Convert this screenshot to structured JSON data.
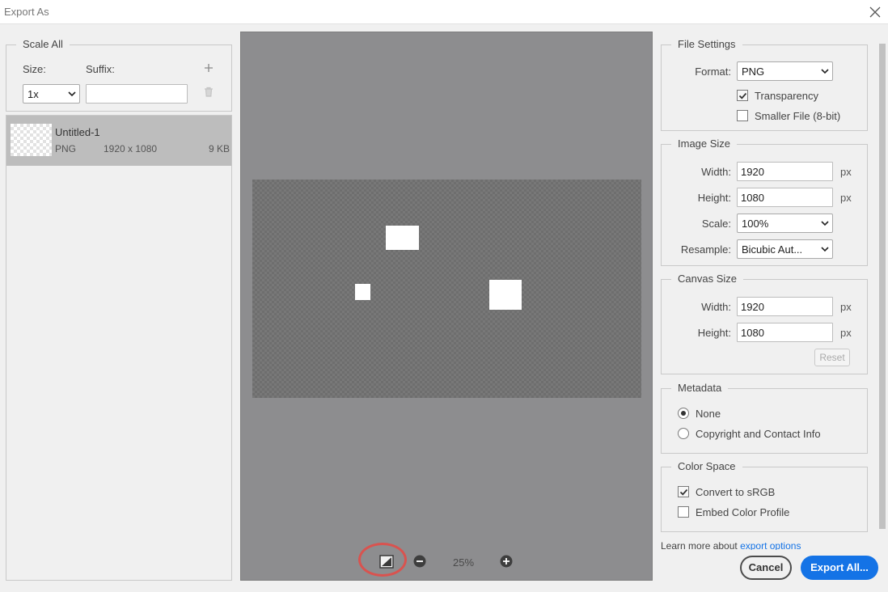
{
  "window": {
    "title": "Export As",
    "close_icon": "close-icon"
  },
  "left": {
    "scale_all_legend": "Scale All",
    "size_label": "Size:",
    "suffix_label": "Suffix:",
    "size_value": "1x",
    "suffix_value": "",
    "add_icon": "plus-icon",
    "delete_icon": "trash-icon",
    "asset": {
      "name": "Untitled-1",
      "format": "PNG",
      "dimensions": "1920 x 1080",
      "filesize": "9 KB"
    }
  },
  "preview": {
    "zoom_level": "25%",
    "toggle_icon": "toggle-background-icon",
    "zoom_out_icon": "zoom-out-icon",
    "zoom_in_icon": "zoom-in-icon"
  },
  "file_settings": {
    "legend": "File Settings",
    "format_label": "Format:",
    "format_value": "PNG",
    "transparency_label": "Transparency",
    "transparency_checked": true,
    "smaller_file_label": "Smaller File (8-bit)",
    "smaller_file_checked": false
  },
  "image_size": {
    "legend": "Image Size",
    "width_label": "Width:",
    "width_value": "1920",
    "height_label": "Height:",
    "height_value": "1080",
    "scale_label": "Scale:",
    "scale_value": "100%",
    "resample_label": "Resample:",
    "resample_value": "Bicubic Aut...",
    "unit": "px"
  },
  "canvas_size": {
    "legend": "Canvas Size",
    "width_label": "Width:",
    "width_value": "1920",
    "height_label": "Height:",
    "height_value": "1080",
    "unit": "px",
    "reset_label": "Reset"
  },
  "metadata": {
    "legend": "Metadata",
    "none_label": "None",
    "copyright_label": "Copyright and Contact Info",
    "selected": "None"
  },
  "color_space": {
    "legend": "Color Space",
    "convert_label": "Convert to sRGB",
    "convert_checked": true,
    "embed_label": "Embed Color Profile",
    "embed_checked": false
  },
  "footer": {
    "learn_prefix": "Learn more about ",
    "learn_link": "export options",
    "cancel_label": "Cancel",
    "export_label": "Export All..."
  },
  "colors": {
    "accent": "#1473e6",
    "highlight": "#d9534f",
    "preview_bg": "#8d8d8f"
  }
}
